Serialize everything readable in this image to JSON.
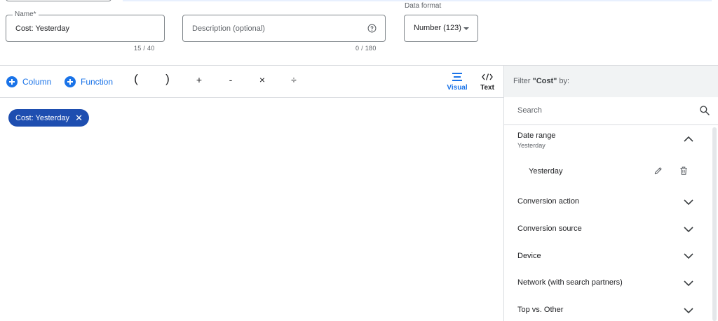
{
  "form": {
    "name_label": "Name*",
    "name_value": "Cost: Yesterday",
    "name_counter": "15 / 40",
    "description_placeholder": "Description (optional)",
    "description_counter": "0 / 180",
    "data_format_label": "Data format",
    "data_format_value": "Number (123)"
  },
  "toolbar": {
    "column_label": "Column",
    "function_label": "Function",
    "operators": [
      "(",
      ")",
      "+",
      "-",
      "×",
      "÷"
    ],
    "visual_label": "Visual",
    "text_label": "Text"
  },
  "editor": {
    "chip_label": "Cost: Yesterday"
  },
  "filter_panel": {
    "header_prefix": "Filter ",
    "header_metric": "\"Cost\"",
    "header_suffix": " by:",
    "search_placeholder": "Search",
    "date_range": {
      "title": "Date range",
      "subtitle": "Yesterday",
      "selected_item": "Yesterday"
    },
    "items": [
      "Conversion action",
      "Conversion source",
      "Device",
      "Network (with search partners)",
      "Top vs. Other"
    ]
  },
  "colors": {
    "accent": "#1a73e8",
    "chip": "#1e4eb0",
    "panel_header_bg": "#f1f3f4",
    "divider": "#dadce0"
  }
}
